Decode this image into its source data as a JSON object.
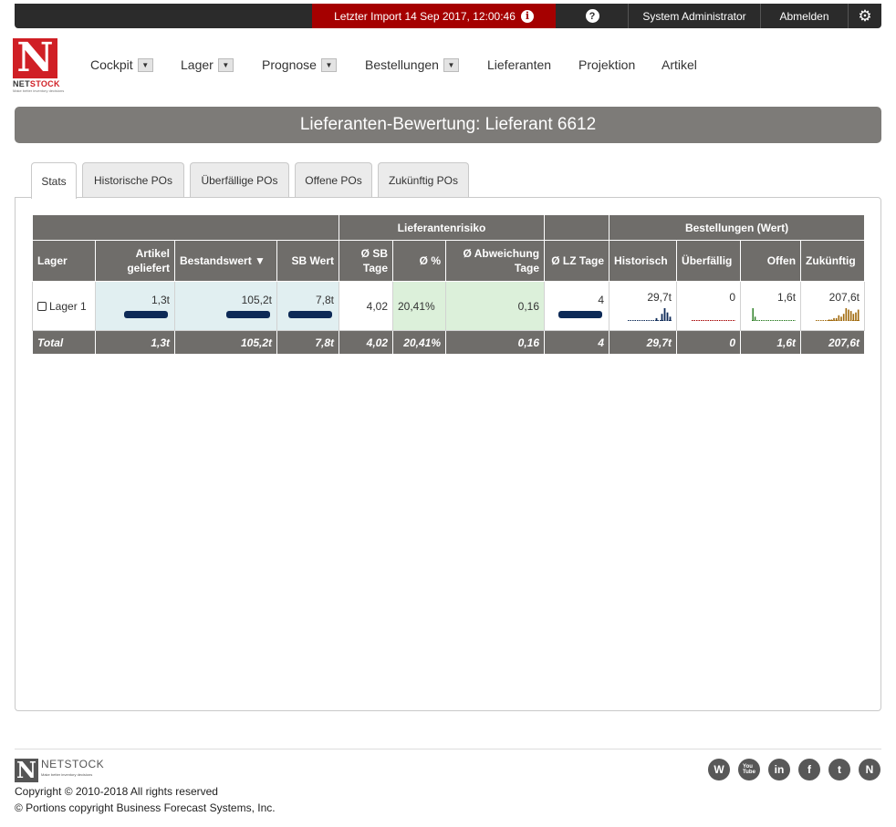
{
  "topbar": {
    "import_text": "Letzter Import 14 Sep 2017, 12:00:46",
    "user": "System Administrator",
    "logout": "Abmelden"
  },
  "logo": {
    "brand_net": "NET",
    "brand_stock": "STOCK",
    "tagline": "Make better inventory decisions"
  },
  "nav": {
    "items": [
      {
        "label": "Cockpit"
      },
      {
        "label": "Lager"
      },
      {
        "label": "Prognose"
      },
      {
        "label": "Bestellungen"
      },
      {
        "label": "Lieferanten"
      },
      {
        "label": "Projektion"
      },
      {
        "label": "Artikel"
      }
    ]
  },
  "page_title": "Lieferanten-Bewertung: Lieferant 6612",
  "tabs": [
    {
      "label": "Stats",
      "active": true
    },
    {
      "label": "Historische POs"
    },
    {
      "label": "Überfällige POs"
    },
    {
      "label": "Offene POs"
    },
    {
      "label": "Zukünftig POs"
    }
  ],
  "table": {
    "group_headers": {
      "risk": "Lieferantenrisiko",
      "orders": "Bestellungen (Wert)"
    },
    "headers": {
      "lager": "Lager",
      "artikel": "Artikel geliefert",
      "bestand": "Bestandswert ▼",
      "sb_wert": "SB Wert",
      "sb_tage": "Ø SB Tage",
      "pct": "Ø %",
      "abw": "Ø Abweichung Tage",
      "lz": "Ø LZ Tage",
      "hist": "Historisch",
      "ueber": "Überfällig",
      "offen": "Offen",
      "zuk": "Zukünftig"
    },
    "row": {
      "lager": "Lager 1",
      "artikel": "1,3t",
      "bestand": "105,2t",
      "sb_wert": "7,8t",
      "sb_tage": "4,02",
      "pct": "20,41%",
      "abw": "0,16",
      "lz": "4",
      "hist": "29,7t",
      "ueber": "0",
      "offen": "1,6t",
      "zuk": "207,6t"
    },
    "total": {
      "label": "Total",
      "artikel": "1,3t",
      "bestand": "105,2t",
      "sb_wert": "7,8t",
      "sb_tage": "4,02",
      "pct": "20,41%",
      "abw": "0,16",
      "lz": "4",
      "hist": "29,7t",
      "ueber": "0",
      "offen": "1,6t",
      "zuk": "207,6t"
    },
    "sparklines": {
      "hist": {
        "color": "#0d2a57",
        "values": [
          0,
          0,
          0,
          0,
          0,
          0,
          0,
          0,
          0,
          0,
          2,
          0,
          5,
          9,
          6,
          3
        ]
      },
      "ueber": {
        "color": "#a50000",
        "values": [
          0,
          0,
          0,
          0,
          0,
          0,
          0,
          0,
          0,
          0,
          0,
          0,
          0,
          0,
          0,
          0,
          0,
          0,
          0,
          0
        ]
      },
      "offen": {
        "color": "#2a7d22",
        "values": [
          9,
          3,
          0,
          0,
          0,
          0,
          0,
          0,
          0,
          0,
          0,
          0,
          0,
          0,
          0,
          0,
          0,
          0,
          0,
          0
        ]
      },
      "zuk": {
        "color": "#a0680a",
        "values": [
          0,
          0,
          0,
          0,
          0,
          1,
          1,
          2,
          2,
          4,
          3,
          5,
          9,
          8,
          7,
          5,
          6,
          8
        ]
      }
    }
  },
  "footer": {
    "brand": "NETSTOCK",
    "tagline": "Make better inventory decisions",
    "copyright": "Copyright © 2010-2018 All rights reserved",
    "portions": "© Portions copyright Business Forecast Systems, Inc."
  }
}
